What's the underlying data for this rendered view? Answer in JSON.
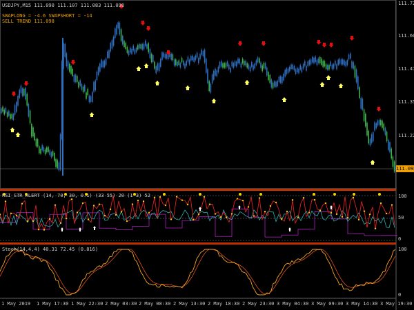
{
  "main": {
    "symbol_line": "USDJPY,M15 111.090 111.107 111.083 111.098",
    "signal_long": "SWAPLONG = -4.6  SWAPSHORT = -14",
    "trend_text": "SELL TREND 111.098",
    "current_price": "111.098",
    "price_axis": [
      "111.725",
      "111.600",
      "111.475",
      "111.350",
      "111.225"
    ]
  },
  "rsi_panel": {
    "label": "RSI_STR_ALERT (14, 70, 30, 0.1) (33 55) 20 (1 3) 52",
    "axis": [
      "100",
      "50",
      "0"
    ]
  },
  "stoch_panel": {
    "label": "Stoch(14,4,4) 40.31 72.45 (0.816)",
    "axis": [
      "100",
      "0"
    ]
  },
  "time_axis": [
    "1 May 2019",
    "1 May 17:30",
    "1 May 22:30",
    "2 May 03:30",
    "2 May 08:30",
    "2 May 13:30",
    "2 May 18:30",
    "2 May 23:30",
    "3 May 04:30",
    "3 May 09:30",
    "3 May 14:30",
    "3 May 19:30"
  ],
  "colors": {
    "background": "#000000",
    "bull_candle": "#2e6fc0",
    "bear_candle": "#3cb34a",
    "buy_arrow": "#ffff66",
    "sell_arrow": "#e01010",
    "separator": "#c03000",
    "stoch_main": "#f5a623",
    "stoch_signal": "#e05020",
    "rsi_line": "#e02020",
    "rsi_teal": "#30b0b0",
    "rsi_purple": "#b020c0",
    "dots": "#f5d000"
  }
}
